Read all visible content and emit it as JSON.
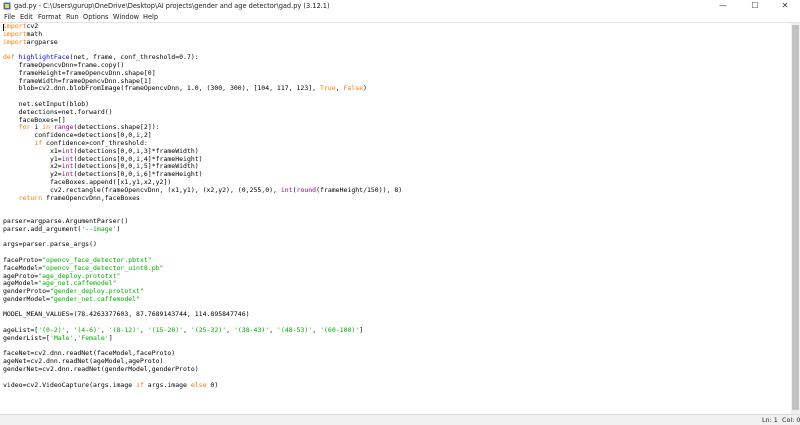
{
  "window": {
    "title": "gad.py - C:\\Users\\gurup\\OneDrive\\Desktop\\AI projects\\gender and age detector\\gad.py (3.12.1)",
    "minimize": "—",
    "maximize": "☐",
    "close": "✕",
    "icon": "python-file-icon"
  },
  "menu": {
    "items": [
      "File",
      "Edit",
      "Format",
      "Run",
      "Options",
      "Window",
      "Help"
    ]
  },
  "editor": {
    "lines": [
      [
        [
          "k",
          "import"
        ],
        [
          "",
          "cv2"
        ]
      ],
      [
        [
          "k",
          "import"
        ],
        [
          "",
          "math"
        ]
      ],
      [
        [
          "k",
          "import"
        ],
        [
          "",
          "argparse"
        ]
      ],
      [],
      [
        [
          "k",
          "def"
        ],
        [
          "",
          " "
        ],
        [
          "f",
          "highlightFace"
        ],
        [
          "",
          "(net, frame, conf_threshold=0.7):"
        ]
      ],
      [
        [
          "",
          "    frameOpencvDnn=frame.copy()"
        ]
      ],
      [
        [
          "",
          "    frameHeight=frameOpencvDnn.shape[0]"
        ]
      ],
      [
        [
          "",
          "    frameWidth=frameOpencvDnn.shape[1]"
        ]
      ],
      [
        [
          "",
          "    blob=cv2.dnn.blobFromImage(frameOpencvDnn, 1.0, (300, 300), [104, 117, 123], "
        ],
        [
          "k",
          "True"
        ],
        [
          "",
          ", "
        ],
        [
          "k",
          "False"
        ],
        [
          "",
          ")"
        ]
      ],
      [],
      [
        [
          "",
          "    net.setInput(blob)"
        ]
      ],
      [
        [
          "",
          "    detections=net.forward()"
        ]
      ],
      [
        [
          "",
          "    faceBoxes=[]"
        ]
      ],
      [
        [
          "",
          "    "
        ],
        [
          "k",
          "for"
        ],
        [
          "",
          " i "
        ],
        [
          "k",
          "in"
        ],
        [
          "",
          " "
        ],
        [
          "b",
          "range"
        ],
        [
          "",
          "(detections.shape[2]):"
        ]
      ],
      [
        [
          "",
          "        confidence=detections[0,0,i,2]"
        ]
      ],
      [
        [
          "",
          "        "
        ],
        [
          "k",
          "if"
        ],
        [
          "",
          " confidence>conf_threshold:"
        ]
      ],
      [
        [
          "",
          "            x1="
        ],
        [
          "b",
          "int"
        ],
        [
          "",
          "(detections[0,0,i,3]*frameWidth)"
        ]
      ],
      [
        [
          "",
          "            y1="
        ],
        [
          "b",
          "int"
        ],
        [
          "",
          "(detections[0,0,i,4]*frameHeight)"
        ]
      ],
      [
        [
          "",
          "            x2="
        ],
        [
          "b",
          "int"
        ],
        [
          "",
          "(detections[0,0,i,5]*frameWidth)"
        ]
      ],
      [
        [
          "",
          "            y2="
        ],
        [
          "b",
          "int"
        ],
        [
          "",
          "(detections[0,0,i,6]*frameHeight)"
        ]
      ],
      [
        [
          "",
          "            faceBoxes.append([x1,y1,x2,y2])"
        ]
      ],
      [
        [
          "",
          "            cv2.rectangle(frameOpencvDnn, (x1,y1), (x2,y2), (0,255,0), "
        ],
        [
          "b",
          "int"
        ],
        [
          "",
          "("
        ],
        [
          "b",
          "round"
        ],
        [
          "",
          "(frameHeight/150)), 8)"
        ]
      ],
      [
        [
          "",
          "    "
        ],
        [
          "k",
          "return"
        ],
        [
          "",
          " frameOpencvDnn,faceBoxes"
        ]
      ],
      [],
      [],
      [
        [
          "",
          "parser=argparse.ArgumentParser()"
        ]
      ],
      [
        [
          "",
          "parser.add_argument("
        ],
        [
          "s",
          "'--image'"
        ],
        [
          "",
          ")"
        ]
      ],
      [],
      [
        [
          "",
          "args=parser.parse_args()"
        ]
      ],
      [],
      [
        [
          "",
          "faceProto="
        ],
        [
          "s",
          "\"opencv_face_detector.pbtxt\""
        ]
      ],
      [
        [
          "",
          "faceModel="
        ],
        [
          "s",
          "\"opencv_face_detector_uint8.pb\""
        ]
      ],
      [
        [
          "",
          "ageProto="
        ],
        [
          "s",
          "\"age_deploy.prototxt\""
        ]
      ],
      [
        [
          "",
          "ageModel="
        ],
        [
          "s",
          "\"age_net.caffemodel\""
        ]
      ],
      [
        [
          "",
          "genderProto="
        ],
        [
          "s",
          "\"gender_deploy.prototxt\""
        ]
      ],
      [
        [
          "",
          "genderModel="
        ],
        [
          "s",
          "\"gender_net.caffemodel\""
        ]
      ],
      [],
      [
        [
          "",
          "MODEL_MEAN_VALUES=(78.4263377603, 87.7689143744, 114.895847746)"
        ]
      ],
      [],
      [
        [
          "",
          "ageList=["
        ],
        [
          "s",
          "'(0-2)'"
        ],
        [
          "",
          ", "
        ],
        [
          "s",
          "'(4-6)'"
        ],
        [
          "",
          ", "
        ],
        [
          "s",
          "'(8-12)'"
        ],
        [
          "",
          ", "
        ],
        [
          "s",
          "'(15-20)'"
        ],
        [
          "",
          ", "
        ],
        [
          "s",
          "'(25-32)'"
        ],
        [
          "",
          ", "
        ],
        [
          "s",
          "'(38-43)'"
        ],
        [
          "",
          ", "
        ],
        [
          "s",
          "'(48-53)'"
        ],
        [
          "",
          ", "
        ],
        [
          "s",
          "'(60-100)'"
        ],
        [
          "",
          "]"
        ]
      ],
      [
        [
          "",
          "genderList=["
        ],
        [
          "s",
          "'Male'"
        ],
        [
          "",
          ","
        ],
        [
          "s",
          "'Female'"
        ],
        [
          "",
          "]"
        ]
      ],
      [],
      [
        [
          "",
          "faceNet=cv2.dnn.readNet(faceModel,faceProto)"
        ]
      ],
      [
        [
          "",
          "ageNet=cv2.dnn.readNet(ageModel,ageProto)"
        ]
      ],
      [
        [
          "",
          "genderNet=cv2.dnn.readNet(genderModel,genderProto)"
        ]
      ],
      [],
      [
        [
          "",
          "video=cv2.VideoCapture(args.image "
        ],
        [
          "k",
          "if"
        ],
        [
          "",
          " args.image "
        ],
        [
          "k",
          "else"
        ],
        [
          "",
          " 0)"
        ]
      ]
    ]
  },
  "status": {
    "line": "Ln: 1",
    "col": "Col: 0"
  }
}
